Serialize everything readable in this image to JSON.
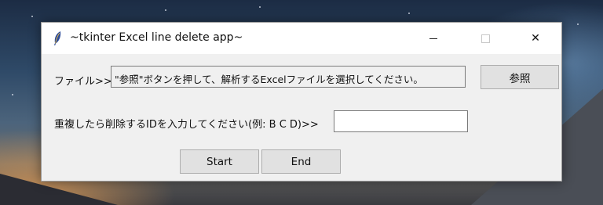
{
  "window": {
    "title": "~tkinter Excel line delete app~",
    "app_icon": "feather-icon",
    "controls": {
      "minimize": "minimize-icon",
      "maximize": "maximize-icon",
      "close": "✕"
    }
  },
  "form": {
    "file_label": "ファイル>>",
    "file_display_value": "\"参照\"ボタンを押して、解析するExcelファイルを選択してください。",
    "browse_button_label": "参照",
    "id_label": "重複したら削除するIDを入力してください(例: B C D)>>",
    "id_input_value": "",
    "start_button_label": "Start",
    "end_button_label": "End"
  },
  "colors": {
    "window_bg": "#f0f0f0",
    "titlebar_bg": "#ffffff",
    "button_bg": "#e1e1e1",
    "button_border": "#adadad"
  }
}
